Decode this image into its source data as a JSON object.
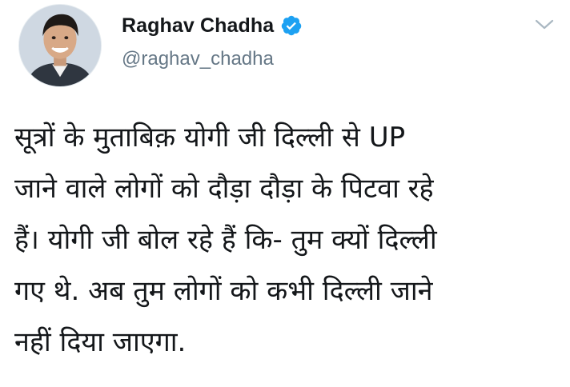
{
  "author": {
    "display_name": "Raghav Chadha",
    "handle": "@raghav_chadha",
    "verified": true,
    "avatar_icon": "profile-photo",
    "verified_icon": "verified-badge-icon",
    "verified_color": "#1da1f2"
  },
  "menu": {
    "icon": "chevron-down-icon"
  },
  "tweet": {
    "text": "सूत्रों के मुताबिक़ योगी जी दिल्ली से UP\nजाने वाले लोगों को दौड़ा दौड़ा के पिटवा रहे\nहैं। योगी जी बोल रहे हैं कि- तुम क्यों दिल्ली\nगए थे. अब तुम लोगों को कभी दिल्ली जाने\nनहीं दिया जाएगा."
  },
  "colors": {
    "text_primary": "#14171a",
    "text_secondary": "#657786",
    "accent": "#1da1f2",
    "background": "#ffffff"
  }
}
